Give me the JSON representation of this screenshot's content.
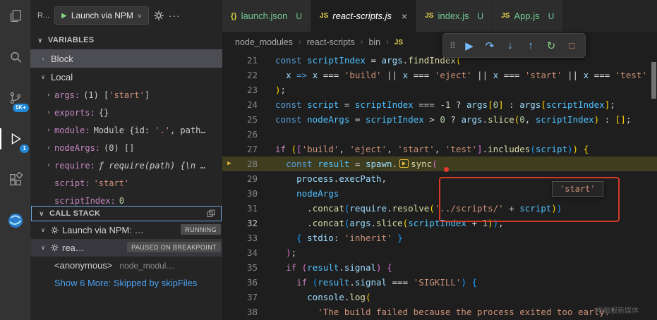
{
  "activity_bar": {
    "items": [
      {
        "name": "explorer"
      },
      {
        "name": "search"
      },
      {
        "name": "source-control",
        "badge": "1K+"
      },
      {
        "name": "run-and-debug",
        "badge": "1",
        "active": true
      },
      {
        "name": "extensions"
      },
      {
        "name": "browser-preview"
      }
    ]
  },
  "sidebar": {
    "title": "R...",
    "launch": {
      "label": "Launch via NPM"
    },
    "variables": {
      "label": "VARIABLES",
      "scopes": [
        {
          "label": "Block"
        },
        {
          "label": "Local"
        }
      ],
      "items": [
        {
          "chev": true,
          "name": "args:",
          "value": [
            [
              "pln",
              "(1) ["
            ],
            [
              "str",
              "'start'"
            ],
            [
              "pln",
              "]"
            ]
          ]
        },
        {
          "chev": true,
          "name": "exports:",
          "value": [
            [
              "pln",
              "{}"
            ]
          ]
        },
        {
          "chev": true,
          "name": "module:",
          "value": [
            [
              "pln",
              "Module {id: "
            ],
            [
              "str",
              "'.'"
            ],
            [
              "pln",
              ", path…"
            ]
          ]
        },
        {
          "chev": true,
          "name": "nodeArgs:",
          "value": [
            [
              "pln",
              "(0) []"
            ]
          ]
        },
        {
          "chev": true,
          "name": "require:",
          "italic": true,
          "value": [
            [
              "pln",
              "ƒ require(path) {\\n …"
            ]
          ]
        },
        {
          "chev": false,
          "name": "script:",
          "value": [
            [
              "str",
              "'start'"
            ]
          ]
        },
        {
          "chev": false,
          "name": "scriptIndex:",
          "value": [
            [
              "num",
              "0"
            ]
          ]
        }
      ]
    },
    "call_stack": {
      "label": "CALL STACK",
      "rows": [
        {
          "type": "session",
          "label": "Launch via NPM: …",
          "badge": "RUNNING"
        },
        {
          "type": "session",
          "label": "rea…",
          "badge": "PAUSED ON BREAKPOINT",
          "selected": true
        },
        {
          "type": "frame",
          "label": "<anonymous>",
          "detail": "node_modul…"
        },
        {
          "type": "link",
          "label": "Show 6 More: Skipped by skipFiles"
        }
      ]
    }
  },
  "editor": {
    "tabs": [
      {
        "icon": "json",
        "label": "launch.json",
        "badge": "U",
        "green": true
      },
      {
        "icon": "js",
        "label": "react-scripts.js",
        "active": true,
        "italic": true,
        "close": true
      },
      {
        "icon": "js",
        "label": "index.js",
        "badge": "U",
        "green": true
      },
      {
        "icon": "js",
        "label": "App.js",
        "badge": "U",
        "green": true
      }
    ],
    "breadcrumb": [
      "node_modules",
      "react-scripts",
      "bin"
    ],
    "debug_toolbar": [
      {
        "name": "drag-handle",
        "glyph": "⠿",
        "color": "gray"
      },
      {
        "name": "continue",
        "glyph": "▶",
        "color": "blue"
      },
      {
        "name": "step-over",
        "glyph": "↷",
        "color": "blue"
      },
      {
        "name": "step-into",
        "glyph": "↓",
        "color": "blue"
      },
      {
        "name": "step-out",
        "glyph": "↑",
        "color": "blue"
      },
      {
        "name": "restart",
        "glyph": "↻",
        "color": "green"
      },
      {
        "name": "stop",
        "glyph": "□",
        "color": "red"
      }
    ],
    "hover_value": "'start'",
    "code": {
      "lines": [
        {
          "n": 21,
          "t": [
            [
              "kw",
              "const "
            ],
            [
              "var2",
              "scriptIndex"
            ],
            [
              "pln",
              " = "
            ],
            [
              "var",
              "args"
            ],
            [
              "pln",
              "."
            ],
            [
              "fn",
              "findIndex"
            ],
            [
              "b1",
              "("
            ]
          ]
        },
        {
          "n": 22,
          "t": [
            [
              "pln",
              "  "
            ],
            [
              "var",
              "x"
            ],
            [
              "kw",
              " => "
            ],
            [
              "var",
              "x"
            ],
            [
              "pln",
              " === "
            ],
            [
              "str",
              "'build'"
            ],
            [
              "pln",
              " || "
            ],
            [
              "var",
              "x"
            ],
            [
              "pln",
              " === "
            ],
            [
              "str",
              "'eject'"
            ],
            [
              "pln",
              " || "
            ],
            [
              "var",
              "x"
            ],
            [
              "pln",
              " === "
            ],
            [
              "str",
              "'start'"
            ],
            [
              "pln",
              " || "
            ],
            [
              "var",
              "x"
            ],
            [
              "pln",
              " === "
            ],
            [
              "str",
              "'test'"
            ]
          ]
        },
        {
          "n": 23,
          "t": [
            [
              "b1",
              ")"
            ],
            [
              "pln",
              ";"
            ]
          ]
        },
        {
          "n": 24,
          "t": [
            [
              "kw",
              "const "
            ],
            [
              "var2",
              "script"
            ],
            [
              "pln",
              " = "
            ],
            [
              "var2",
              "scriptIndex"
            ],
            [
              "pln",
              " === -"
            ],
            [
              "num",
              "1"
            ],
            [
              "pln",
              " ? "
            ],
            [
              "var",
              "args"
            ],
            [
              "b1",
              "["
            ],
            [
              "num",
              "0"
            ],
            [
              "b1",
              "]"
            ],
            [
              "pln",
              " : "
            ],
            [
              "var",
              "args"
            ],
            [
              "b1",
              "["
            ],
            [
              "var2",
              "scriptIndex"
            ],
            [
              "b1",
              "]"
            ],
            [
              "pln",
              ";"
            ]
          ]
        },
        {
          "n": 25,
          "t": [
            [
              "kw",
              "const "
            ],
            [
              "var2",
              "nodeArgs"
            ],
            [
              "pln",
              " = "
            ],
            [
              "var2",
              "scriptIndex"
            ],
            [
              "pln",
              " > "
            ],
            [
              "num",
              "0"
            ],
            [
              "pln",
              " ? "
            ],
            [
              "var",
              "args"
            ],
            [
              "pln",
              "."
            ],
            [
              "fn",
              "slice"
            ],
            [
              "b1",
              "("
            ],
            [
              "num",
              "0"
            ],
            [
              "pln",
              ", "
            ],
            [
              "var2",
              "scriptIndex"
            ],
            [
              "b1",
              ")"
            ],
            [
              "pln",
              " : "
            ],
            [
              "b1",
              "[]"
            ],
            [
              "pln",
              ";"
            ]
          ]
        },
        {
          "n": 26,
          "t": []
        },
        {
          "n": 27,
          "t": [
            [
              "ctrl",
              "if "
            ],
            [
              "b1",
              "("
            ],
            [
              "b2",
              "["
            ],
            [
              "str",
              "'build'"
            ],
            [
              "pln",
              ", "
            ],
            [
              "str",
              "'eject'"
            ],
            [
              "pln",
              ", "
            ],
            [
              "str",
              "'start'"
            ],
            [
              "pln",
              ", "
            ],
            [
              "str",
              "'test'"
            ],
            [
              "b2",
              "]"
            ],
            [
              "pln",
              "."
            ],
            [
              "fn",
              "includes"
            ],
            [
              "b3",
              "("
            ],
            [
              "var2",
              "script"
            ],
            [
              "b3",
              ")"
            ],
            [
              "b1",
              ")"
            ],
            [
              "b1",
              " {"
            ]
          ]
        },
        {
          "n": 28,
          "hl": true,
          "arrow": true,
          "t": [
            [
              "pln",
              "  "
            ],
            [
              "kw",
              "const "
            ],
            [
              "var2",
              "result"
            ],
            [
              "pln",
              " = "
            ],
            [
              "var",
              "spawn"
            ],
            [
              "pln",
              "."
            ],
            [
              "dbgicon",
              ""
            ],
            [
              "fn",
              "sync"
            ],
            [
              "b2",
              "("
            ]
          ]
        },
        {
          "n": 29,
          "t": [
            [
              "pln",
              "    "
            ],
            [
              "var",
              "process"
            ],
            [
              "pln",
              "."
            ],
            [
              "var",
              "execPath"
            ],
            [
              "pln",
              ","
            ]
          ]
        },
        {
          "n": 30,
          "t": [
            [
              "pln",
              "    "
            ],
            [
              "var2",
              "nodeArgs"
            ]
          ]
        },
        {
          "n": 31,
          "t": [
            [
              "pln",
              "      ."
            ],
            [
              "fn",
              "concat"
            ],
            [
              "b3",
              "("
            ],
            [
              "var",
              "require"
            ],
            [
              "pln",
              "."
            ],
            [
              "fn",
              "resolve"
            ],
            [
              "b1",
              "("
            ],
            [
              "str",
              "'../scripts/'"
            ],
            [
              "pln",
              " + "
            ],
            [
              "var2",
              "script"
            ],
            [
              "b1",
              ")"
            ],
            [
              "b3",
              ")"
            ]
          ]
        },
        {
          "n": 32,
          "cur": true,
          "t": [
            [
              "pln",
              "      ."
            ],
            [
              "fn",
              "concat"
            ],
            [
              "b3",
              "("
            ],
            [
              "var",
              "args"
            ],
            [
              "pln",
              "."
            ],
            [
              "fn",
              "slice"
            ],
            [
              "b1",
              "("
            ],
            [
              "var2",
              "scriptIndex"
            ],
            [
              "pln",
              " + "
            ],
            [
              "num",
              "1"
            ],
            [
              "b1",
              ")"
            ],
            [
              "b3",
              ")"
            ],
            [
              "pln",
              ","
            ]
          ]
        },
        {
          "n": 33,
          "t": [
            [
              "pln",
              "    "
            ],
            [
              "b3",
              "{"
            ],
            [
              "pln",
              " "
            ],
            [
              "var",
              "stdio"
            ],
            [
              "pln",
              ": "
            ],
            [
              "str",
              "'inherit'"
            ],
            [
              "pln",
              " "
            ],
            [
              "b3",
              "}"
            ]
          ]
        },
        {
          "n": 34,
          "t": [
            [
              "pln",
              "  "
            ],
            [
              "b2",
              ")"
            ],
            [
              "pln",
              ";"
            ]
          ]
        },
        {
          "n": 35,
          "t": [
            [
              "pln",
              "  "
            ],
            [
              "ctrl",
              "if "
            ],
            [
              "b2",
              "("
            ],
            [
              "var2",
              "result"
            ],
            [
              "pln",
              "."
            ],
            [
              "var",
              "signal"
            ],
            [
              "b2",
              ")"
            ],
            [
              "b2",
              " {"
            ]
          ]
        },
        {
          "n": 36,
          "t": [
            [
              "pln",
              "    "
            ],
            [
              "ctrl",
              "if "
            ],
            [
              "b3",
              "("
            ],
            [
              "var2",
              "result"
            ],
            [
              "pln",
              "."
            ],
            [
              "var",
              "signal"
            ],
            [
              "pln",
              " === "
            ],
            [
              "str",
              "'SIGKILL'"
            ],
            [
              "b3",
              ")"
            ],
            [
              "b3",
              " {"
            ]
          ]
        },
        {
          "n": 37,
          "t": [
            [
              "pln",
              "      "
            ],
            [
              "var",
              "console"
            ],
            [
              "pln",
              "."
            ],
            [
              "fn",
              "log"
            ],
            [
              "b1",
              "("
            ]
          ]
        },
        {
          "n": 38,
          "t": [
            [
              "pln",
              "        "
            ],
            [
              "str",
              "'The build failed because the process exited too early.'"
            ]
          ]
        }
      ]
    }
  },
  "watermark": "电脑报新媒体",
  "colors": {
    "accent_blue": "#007acc",
    "badge_blue": "#2188d6",
    "untracked_green": "#73c991",
    "string_orange": "#ce9178",
    "annotation_red": "#d23a27",
    "paused_line_olive": "#3f3d20",
    "link_blue": "#4ba0f0"
  }
}
